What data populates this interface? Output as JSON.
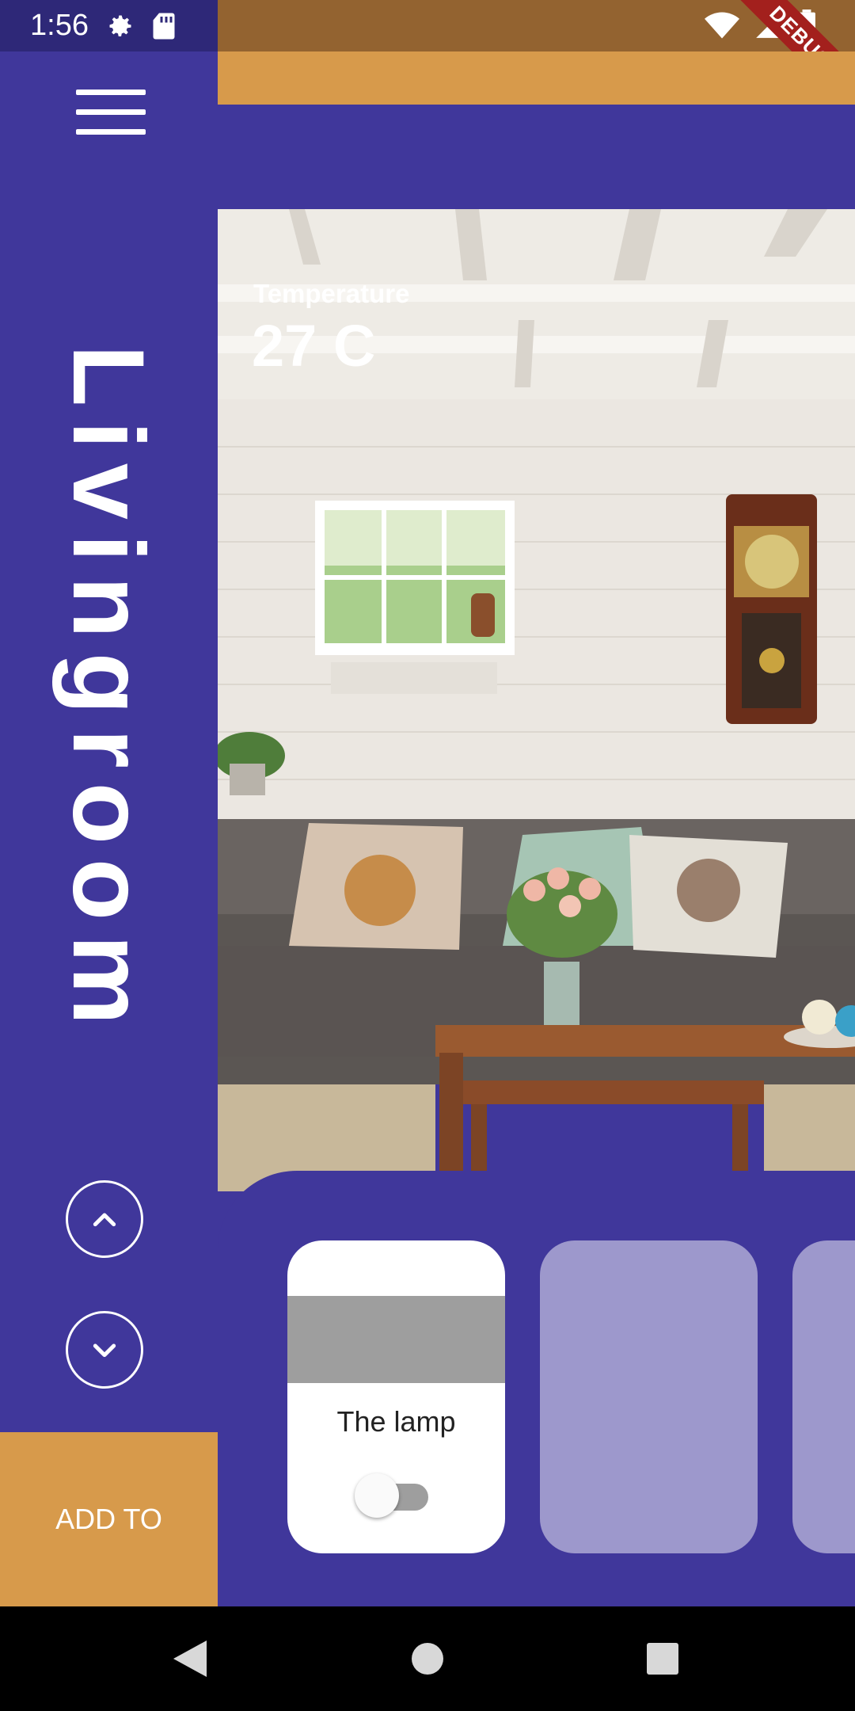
{
  "status_bar": {
    "time": "1:56",
    "debug_label": "DEBUG",
    "icons": [
      "gear-icon",
      "sd-card-icon",
      "wifi-icon",
      "signal-icon",
      "battery-icon"
    ]
  },
  "sidebar": {
    "room_name": "Livingroom",
    "add_to_label": "ADD TO",
    "icons": [
      "menu-icon",
      "chevron-up-icon",
      "chevron-down-icon"
    ]
  },
  "room": {
    "temperature_label": "Temperature",
    "temperature_value": "27 C"
  },
  "devices": [
    {
      "name": "The lamp",
      "switch_on": false
    }
  ],
  "colors": {
    "primary": "#40379b",
    "accent": "#d79a4b",
    "card_inactive": "#9d98cc",
    "debug_banner": "#a3201d"
  }
}
